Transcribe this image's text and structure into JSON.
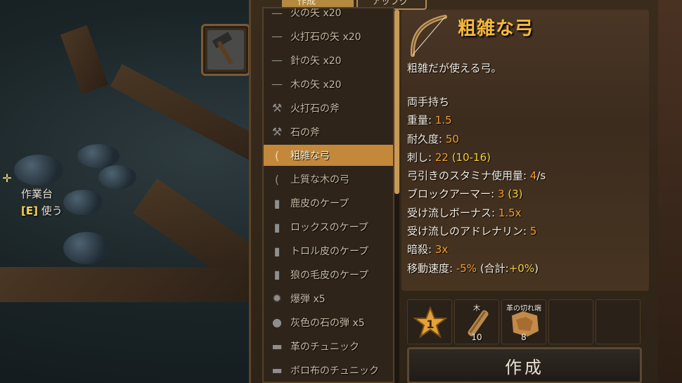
{
  "hud": {
    "interact_name": "作業台",
    "interact_key": "[E]",
    "interact_action": "使う"
  },
  "tabs": [
    "作成",
    "アップグレード"
  ],
  "recipes": [
    {
      "label": "火の矢 x20",
      "icon": "arrow-icon"
    },
    {
      "label": "火打石の矢 x20",
      "icon": "arrow-icon"
    },
    {
      "label": "針の矢 x20",
      "icon": "arrow-icon"
    },
    {
      "label": "木の矢 x20",
      "icon": "arrow-icon"
    },
    {
      "label": "火打石の斧",
      "icon": "axe-icon"
    },
    {
      "label": "石の斧",
      "icon": "axe-icon"
    },
    {
      "label": "粗雑な弓",
      "icon": "bow-icon",
      "selected": true
    },
    {
      "label": "上質な木の弓",
      "icon": "bow-icon"
    },
    {
      "label": "鹿皮のケープ",
      "icon": "cape-icon"
    },
    {
      "label": "ロックスのケープ",
      "icon": "cape-icon"
    },
    {
      "label": "トロル皮のケープ",
      "icon": "cape-icon"
    },
    {
      "label": "狼の毛皮のケープ",
      "icon": "cape-icon"
    },
    {
      "label": "爆弾 x5",
      "icon": "bomb-icon"
    },
    {
      "label": "灰色の石の弾 x5",
      "icon": "stones-icon"
    },
    {
      "label": "革のチュニック",
      "icon": "tunic-icon"
    },
    {
      "label": "ボロ布のチュニック",
      "icon": "tunic-icon"
    }
  ],
  "detail": {
    "title": "粗雑な弓",
    "description": "粗雑だが使える弓。",
    "stats": {
      "handed": "両手持ち",
      "weight_label": "重量: ",
      "weight": "1.5",
      "durability_label": "耐久度: ",
      "durability": "50",
      "pierce_label": "刺し: ",
      "pierce": "22",
      "pierce_range": "(10-16)",
      "stamina_label": "弓引きのスタミナ使用量: ",
      "stamina": "4",
      "stamina_unit": "/s",
      "block_label": "ブロックアーマー: ",
      "block": "3",
      "block_extra": "(3)",
      "parry_label": "受け流しボーナス: ",
      "parry": "1.5x",
      "adrenaline_label": "受け流しのアドレナリン: ",
      "adrenaline": "5",
      "backstab_label": "暗殺: ",
      "backstab": "3x",
      "movement_label": "移動速度: ",
      "movement": "-5%",
      "movement_total_label": "(合計:",
      "movement_total": "+0%",
      "movement_close": ")"
    }
  },
  "requirements": {
    "station_level": "1",
    "items": [
      {
        "name": "木",
        "qty": "10",
        "icon": "wood-icon"
      },
      {
        "name": "革の切れ端",
        "qty": "8",
        "icon": "leather-scraps-icon"
      }
    ]
  },
  "craft_button": "作成",
  "colors": {
    "accent": "#f7b93a",
    "stat_value": "#f39c2b",
    "selected_row": "#c4883a"
  }
}
